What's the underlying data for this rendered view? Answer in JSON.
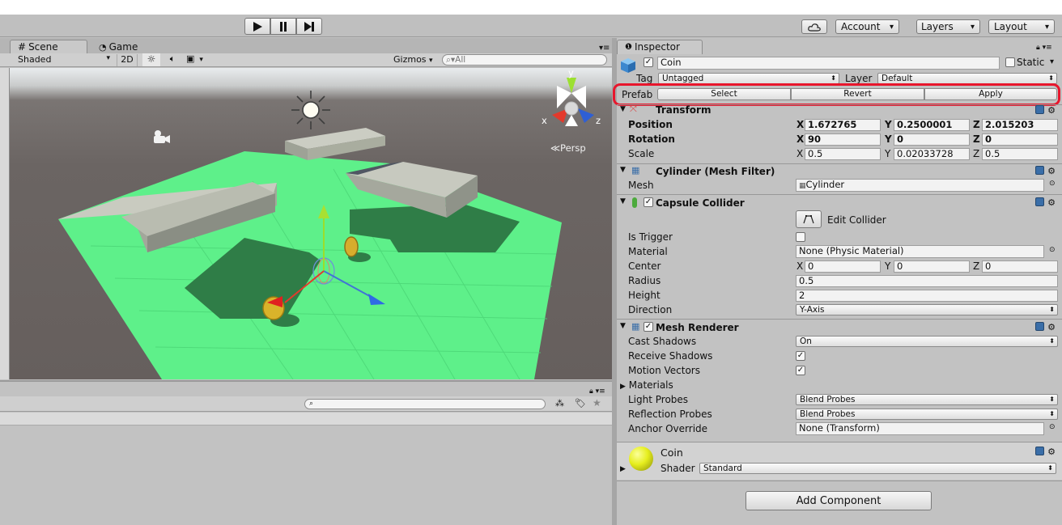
{
  "toolbar": {
    "account": "Account",
    "layers": "Layers",
    "layout": "Layout"
  },
  "scene": {
    "tab_scene": "Scene",
    "tab_game": "Game",
    "shading": "Shaded",
    "mode_2d": "2D",
    "gizmos": "Gizmos",
    "search_placeholder": "All",
    "persp": "Persp",
    "axis_x": "x",
    "axis_y": "y",
    "axis_z": "z"
  },
  "inspector": {
    "tab": "Inspector",
    "object_name": "Coin",
    "static_label": "Static",
    "tag_label": "Tag",
    "tag_value": "Untagged",
    "layer_label": "Layer",
    "layer_value": "Default",
    "prefab_label": "Prefab",
    "prefab_select": "Select",
    "prefab_revert": "Revert",
    "prefab_apply": "Apply",
    "transform": {
      "title": "Transform",
      "position_label": "Position",
      "rotation_label": "Rotation",
      "scale_label": "Scale",
      "position": {
        "x": "1.672765",
        "y": "0.2500001",
        "z": "2.015203"
      },
      "rotation": {
        "x": "90",
        "y": "0",
        "z": "0"
      },
      "scale": {
        "x": "0.5",
        "y": "0.02033728",
        "z": "0.5"
      }
    },
    "mesh_filter": {
      "title": "Cylinder (Mesh Filter)",
      "mesh_label": "Mesh",
      "mesh_value": "Cylinder"
    },
    "collider": {
      "title": "Capsule Collider",
      "edit_label": "Edit Collider",
      "is_trigger_label": "Is Trigger",
      "material_label": "Material",
      "material_value": "None (Physic Material)",
      "center_label": "Center",
      "center": {
        "x": "0",
        "y": "0",
        "z": "0"
      },
      "radius_label": "Radius",
      "radius_value": "0.5",
      "height_label": "Height",
      "height_value": "2",
      "direction_label": "Direction",
      "direction_value": "Y-Axis"
    },
    "renderer": {
      "title": "Mesh Renderer",
      "cast_shadows_label": "Cast Shadows",
      "cast_shadows_value": "On",
      "receive_shadows_label": "Receive Shadows",
      "motion_vectors_label": "Motion Vectors",
      "materials_label": "Materials",
      "light_probes_label": "Light Probes",
      "light_probes_value": "Blend Probes",
      "reflection_probes_label": "Reflection Probes",
      "reflection_probes_value": "Blend Probes",
      "anchor_label": "Anchor Override",
      "anchor_value": "None (Transform)"
    },
    "material": {
      "name": "Coin",
      "shader_label": "Shader",
      "shader_value": "Standard"
    },
    "add_component": "Add Component"
  },
  "colors": {
    "highlight": "#e8162c",
    "ground": "#5ef08a",
    "sky": "#e7eaec"
  }
}
